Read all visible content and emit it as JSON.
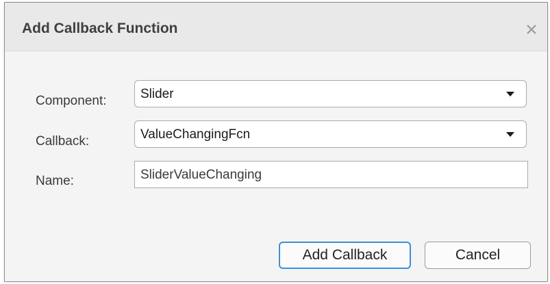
{
  "dialog": {
    "title": "Add Callback Function",
    "close_icon": "close-icon"
  },
  "form": {
    "component": {
      "label": "Component:",
      "value": "Slider"
    },
    "callback": {
      "label": "Callback:",
      "value": "ValueChangingFcn"
    },
    "name": {
      "label": "Name:",
      "value": "SliderValueChanging"
    }
  },
  "buttons": {
    "add_label": "Add Callback",
    "cancel_label": "Cancel"
  },
  "colors": {
    "focus_border": "#3c8fd6",
    "titlebar_bg": "#e9e9e9",
    "dialog_bg": "#f4f4f4"
  }
}
